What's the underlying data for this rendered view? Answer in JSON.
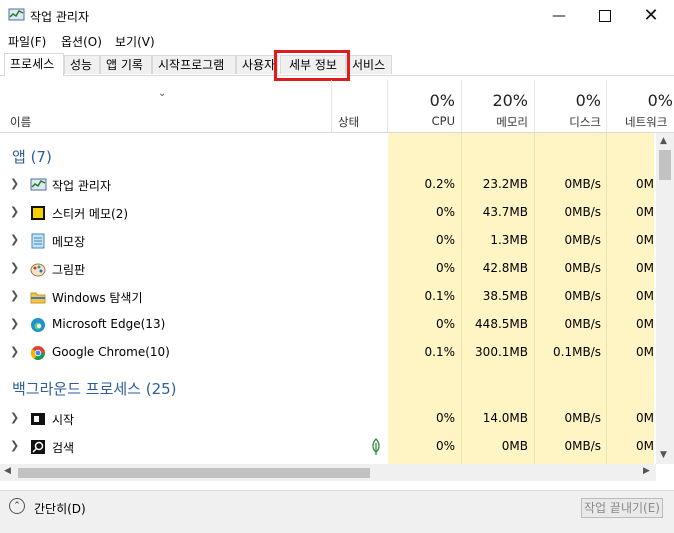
{
  "window": {
    "title": "작업 관리자"
  },
  "menu": [
    "파일(F)",
    "옵션(O)",
    "보기(V)"
  ],
  "tabs": [
    "프로세스",
    "성능",
    "앱 기록",
    "시작프로그램",
    "사용자",
    "세부 정보",
    "서비스"
  ],
  "header": {
    "name_label": "이름",
    "status_label": "상태",
    "cpu": {
      "pct": "0%",
      "label": "CPU"
    },
    "memory": {
      "pct": "20%",
      "label": "메모리"
    },
    "disk": {
      "pct": "0%",
      "label": "디스크"
    },
    "network": {
      "pct": "0%",
      "label": "네트워크"
    }
  },
  "apps_group": "앱 (7)",
  "apps": [
    {
      "name": "작업 관리자",
      "icon": "task-manager-icon",
      "cpu": "0.2%",
      "mem": "23.2MB",
      "disk": "0MB/s",
      "net": "0M"
    },
    {
      "name": "스티커 메모(2)",
      "icon": "sticky-notes-icon",
      "cpu": "0%",
      "mem": "43.7MB",
      "disk": "0MB/s",
      "net": "0M"
    },
    {
      "name": "메모장",
      "icon": "notepad-icon",
      "cpu": "0%",
      "mem": "1.3MB",
      "disk": "0MB/s",
      "net": "0M"
    },
    {
      "name": "그림판",
      "icon": "paint-icon",
      "cpu": "0%",
      "mem": "42.8MB",
      "disk": "0MB/s",
      "net": "0M"
    },
    {
      "name": "Windows 탐색기",
      "icon": "explorer-icon",
      "cpu": "0.1%",
      "mem": "38.5MB",
      "disk": "0MB/s",
      "net": "0M"
    },
    {
      "name": "Microsoft Edge(13)",
      "icon": "edge-icon",
      "cpu": "0%",
      "mem": "448.5MB",
      "disk": "0MB/s",
      "net": "0M"
    },
    {
      "name": "Google Chrome(10)",
      "icon": "chrome-icon",
      "cpu": "0.1%",
      "mem": "300.1MB",
      "disk": "0.1MB/s",
      "net": "0M"
    }
  ],
  "bg_group": "백그라운드 프로세스 (25)",
  "bg": [
    {
      "name": "시작",
      "icon": "start-icon",
      "cpu": "0%",
      "mem": "14.0MB",
      "disk": "0MB/s",
      "net": "0M"
    },
    {
      "name": "검색",
      "icon": "search-icon",
      "cpu": "0%",
      "mem": "0MB",
      "disk": "0MB/s",
      "net": "0M"
    }
  ],
  "footer": {
    "fewer_details": "간단히(D)",
    "end_task": "작업 끝내기(E)"
  }
}
